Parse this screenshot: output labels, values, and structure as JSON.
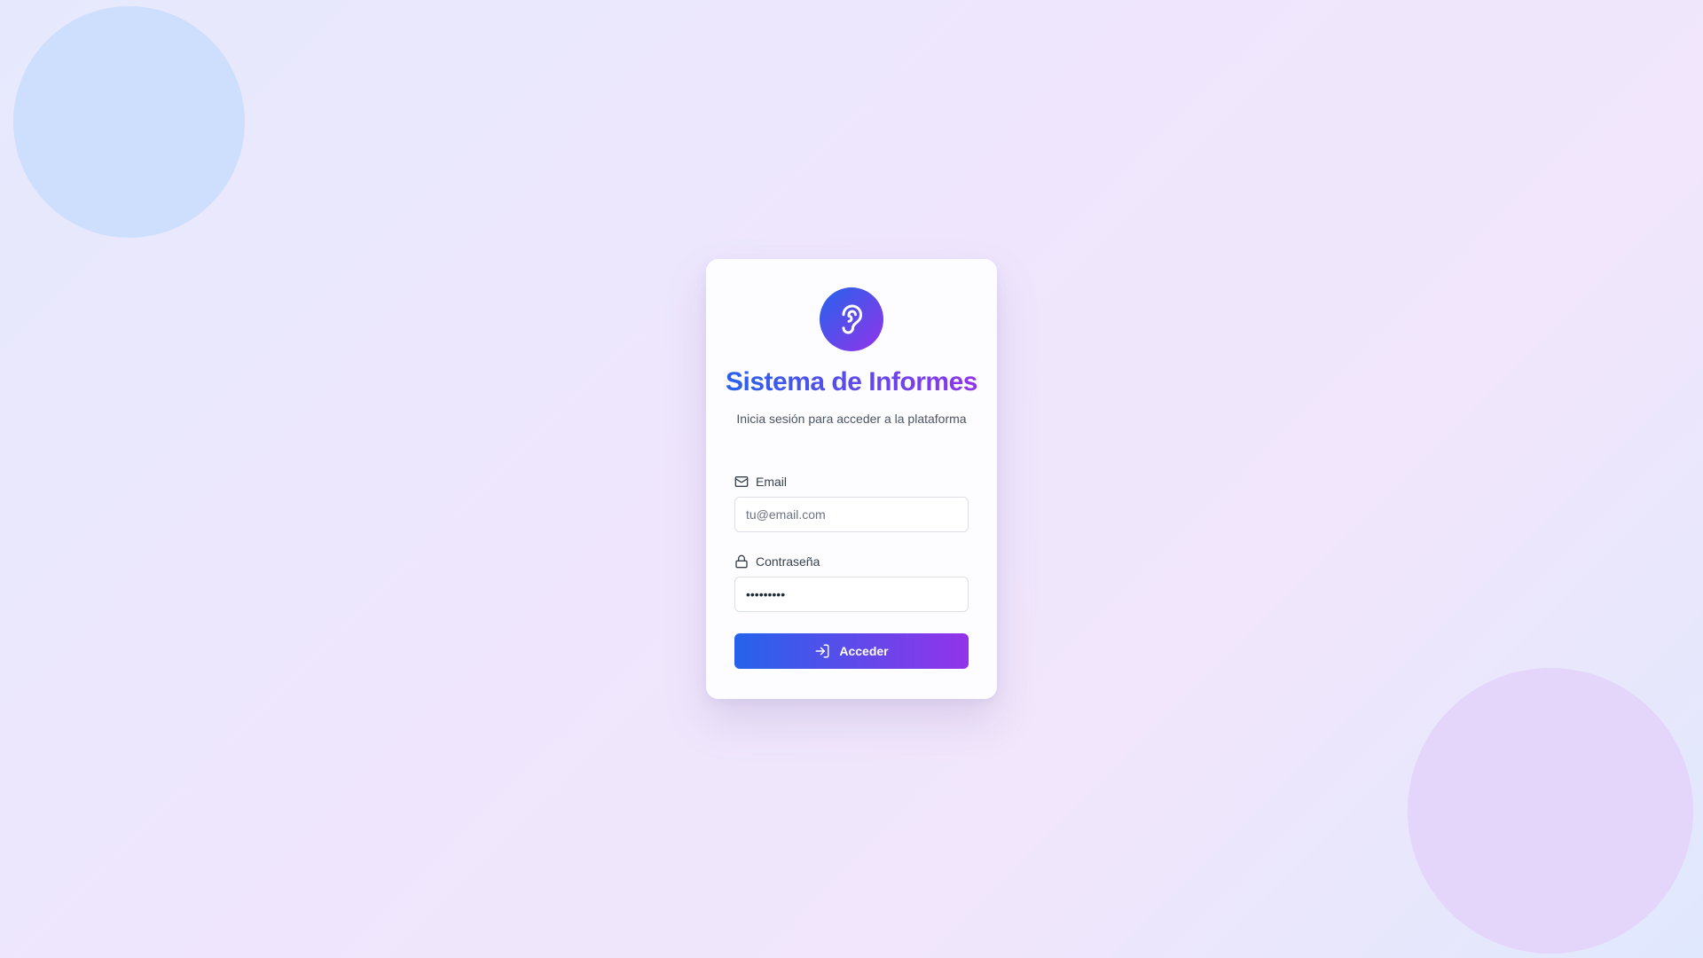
{
  "app": {
    "title": "Sistema de Informes",
    "subtitle": "Inicia sesión para acceder a la plataforma",
    "logo_icon": "ear-icon"
  },
  "form": {
    "email": {
      "label": "Email",
      "icon": "mail-icon",
      "placeholder": "tu@email.com",
      "value": ""
    },
    "password": {
      "label": "Contraseña",
      "icon": "lock-icon",
      "value": "•••••••••"
    },
    "submit": {
      "label": "Acceder",
      "icon": "log-in-icon"
    }
  },
  "colors": {
    "gradient_start": "#2563eb",
    "gradient_end": "#9333ea",
    "label_text": "#374151",
    "subtitle_text": "#4b5563"
  }
}
